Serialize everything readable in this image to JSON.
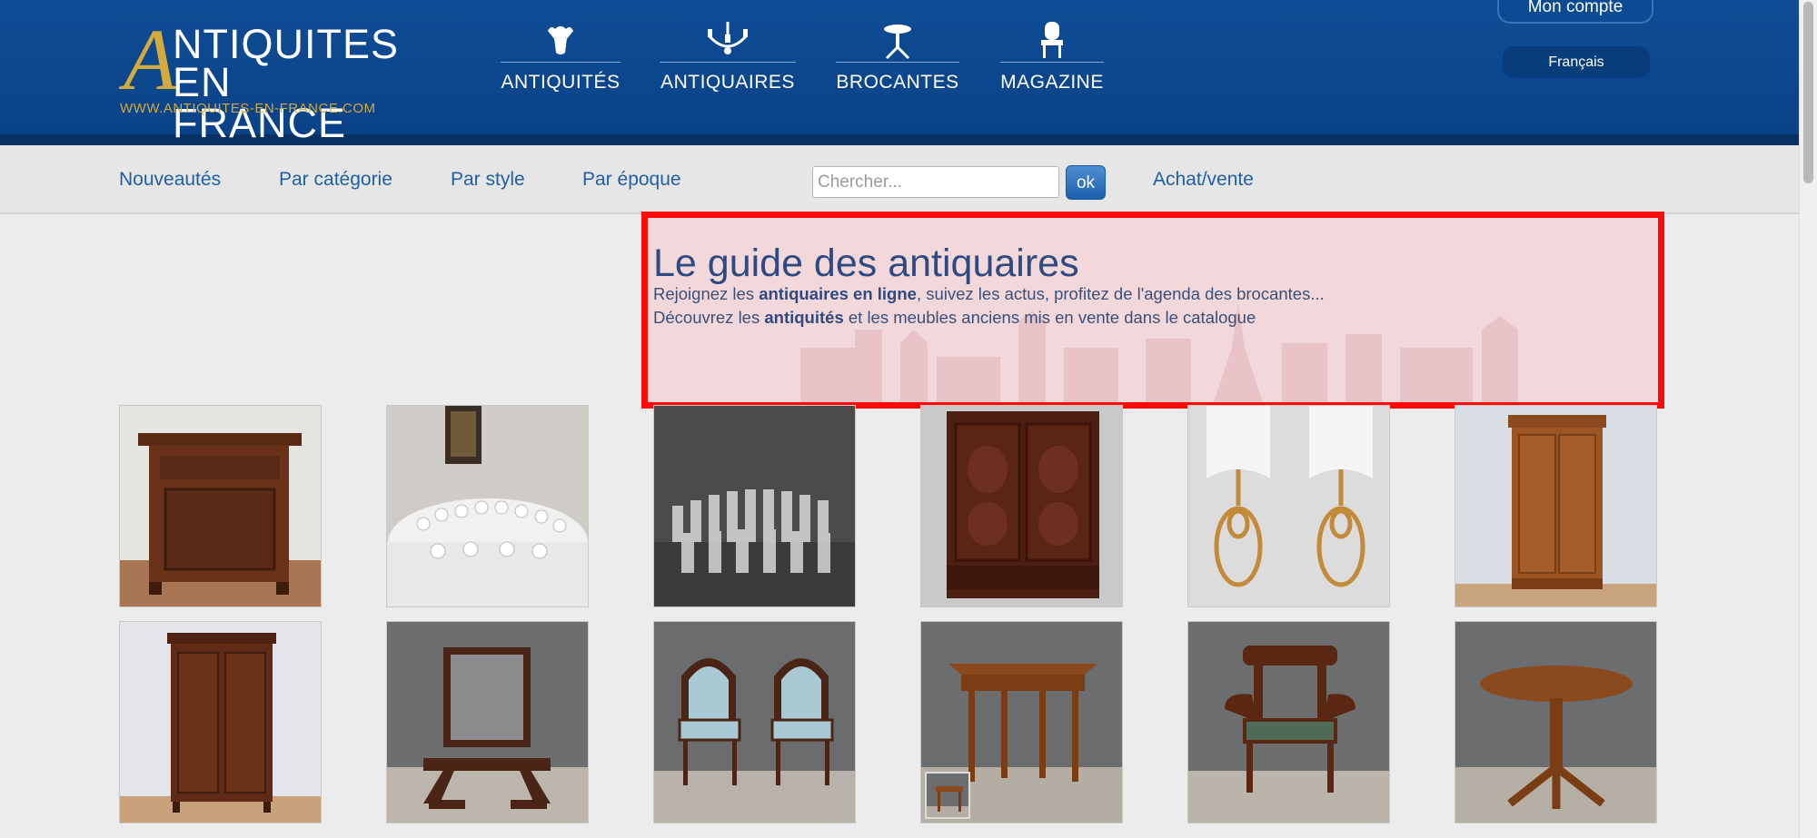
{
  "logo": {
    "big_letter": "A",
    "line1": "NTIQUITES",
    "line2": "EN FRANCE",
    "url": "WWW.ANTIQUITES-EN-FRANCE.COM"
  },
  "top_nav": [
    {
      "label": "ANTIQUITÉS",
      "icon": "cherub-icon"
    },
    {
      "label": "ANTIQUAIRES",
      "icon": "chandelier-icon"
    },
    {
      "label": "BROCANTES",
      "icon": "pedestal-table-icon"
    },
    {
      "label": "MAGAZINE",
      "icon": "armchair-icon"
    }
  ],
  "account": {
    "label": "Mon compte"
  },
  "language": {
    "label": "Français"
  },
  "sub_nav": {
    "new": "Nouveautés",
    "category": "Par catégorie",
    "style": "Par style",
    "era": "Par époque",
    "buy_sell": "Achat/vente"
  },
  "search": {
    "placeholder": "Chercher...",
    "value": "",
    "button": "ok"
  },
  "guide": {
    "title": "Le guide des antiquaires",
    "line1_pre": "Rejoignez les ",
    "line1_bold": "antiquaires en ligne",
    "line1_post": ", suivez les actus, profitez de l'agenda des brocantes...",
    "line2_pre": "Découvrez les ",
    "line2_bold": "antiquités",
    "line2_post": " et les meubles anciens mis en vente dans le catalogue"
  },
  "products": [
    {
      "name": "bedside-cabinet-image"
    },
    {
      "name": "crystal-table-setting-image"
    },
    {
      "name": "crystal-glasses-image"
    },
    {
      "name": "carved-armoire-image"
    },
    {
      "name": "gold-earrings-image"
    },
    {
      "name": "cherry-armoire-image"
    },
    {
      "name": "tall-cabinet-image"
    },
    {
      "name": "psyche-mirror-image"
    },
    {
      "name": "pair-of-chairs-image"
    },
    {
      "name": "demi-lune-table-image"
    },
    {
      "name": "armchair-image"
    },
    {
      "name": "round-pedestal-table-image"
    }
  ],
  "colors": {
    "header": "#0f4d96",
    "gold": "#d3aa3c",
    "link": "#1f5fa8",
    "highlight": "#ff0a0a"
  }
}
